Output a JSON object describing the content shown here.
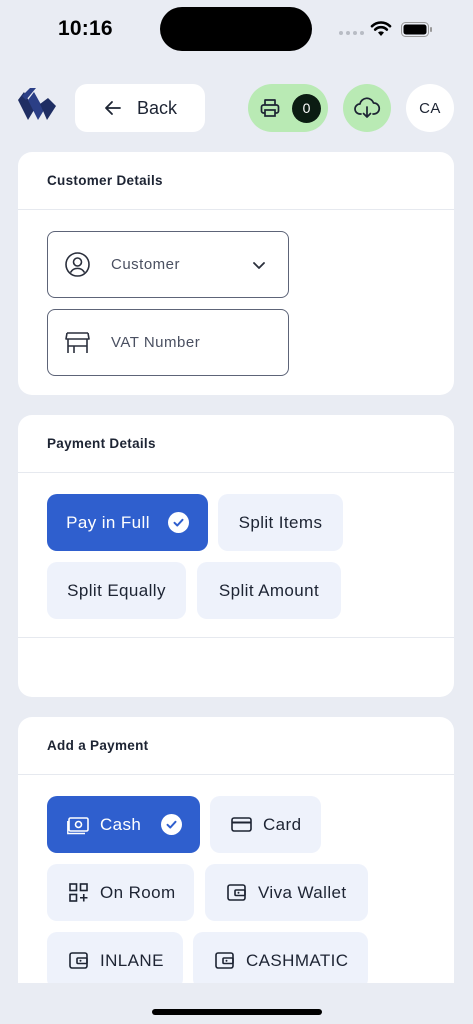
{
  "status_bar": {
    "time": "10:16"
  },
  "header": {
    "back_label": "Back",
    "print_count": "0",
    "avatar_initials": "CA",
    "accent_green": "#b9eab4"
  },
  "customer_details": {
    "title": "Customer Details",
    "customer_placeholder": "Customer",
    "vat_placeholder": "VAT Number"
  },
  "payment_details": {
    "title": "Payment Details",
    "options": [
      {
        "label": "Pay in Full",
        "selected": true
      },
      {
        "label": "Split Items",
        "selected": false
      },
      {
        "label": "Split Equally",
        "selected": false
      },
      {
        "label": "Split Amount",
        "selected": false
      }
    ]
  },
  "add_payment": {
    "title": "Add a Payment",
    "methods": [
      {
        "label": "Cash",
        "icon": "cash-icon",
        "selected": true
      },
      {
        "label": "Card",
        "icon": "card-icon",
        "selected": false
      },
      {
        "label": "On Room",
        "icon": "qr-add-icon",
        "selected": false
      },
      {
        "label": "Viva Wallet",
        "icon": "wallet-icon",
        "selected": false
      },
      {
        "label": "INLANE",
        "icon": "wallet-icon",
        "selected": false
      },
      {
        "label": "CASHMATIC",
        "icon": "wallet-icon",
        "selected": false
      }
    ]
  },
  "colors": {
    "primary": "#2f5fce",
    "background": "#e9ecf3"
  }
}
